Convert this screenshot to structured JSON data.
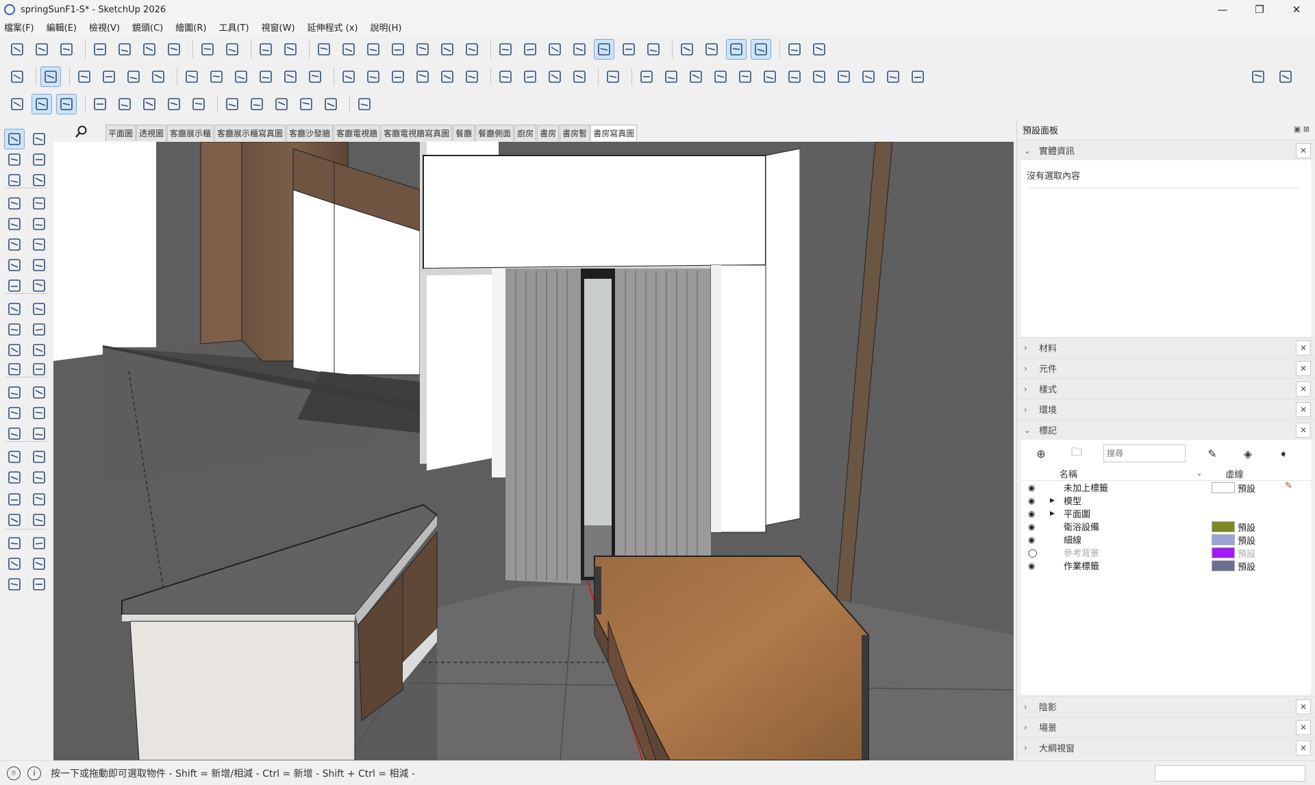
{
  "window": {
    "title": "springSunF1-S* - SketchUp 2026",
    "minimize": "—",
    "restore": "❐",
    "close": "✕"
  },
  "menu": [
    "檔案(F)",
    "編輯(E)",
    "檢視(V)",
    "鏡頭(C)",
    "繪圖(R)",
    "工具(T)",
    "視窗(W)",
    "延伸程式 (x)",
    "說明(H)"
  ],
  "toolbar_row1_icons": [
    "new-file-icon",
    "open-file-icon",
    "save-icon",
    "cut-icon",
    "copy-icon",
    "paste-icon",
    "delete-icon",
    "undo-icon",
    "redo-icon",
    "print-icon",
    "model-info-icon",
    "iso-view-icon",
    "top-view-icon",
    "front-view-icon",
    "right-view-icon",
    "back-view-icon",
    "left-view-icon",
    "bottom-view-icon",
    "xray-icon",
    "backedges-icon",
    "wireframe-icon",
    "hidden-line-icon",
    "shaded-icon",
    "shaded-textures-icon",
    "monochrome-icon",
    "section-plane-icon",
    "section-cut-icon",
    "section-fill-icon",
    "display-section-icon",
    "styles-icon",
    "warehouse-icon"
  ],
  "toolbar_row2_icons": [
    "zoom-icon",
    "select-icon",
    "eraser-icon",
    "pencil-line-icon",
    "arc-icon",
    "rectangle-icon",
    "push-pull-icon",
    "follow-me-icon",
    "move-icon",
    "rotate-icon",
    "scale-icon",
    "flip-icon",
    "paint-bucket-icon",
    "tape-measure-icon",
    "orbit-icon",
    "pan-icon",
    "zoom-window-icon",
    "zoom-extents-icon",
    "sandbox-icon",
    "solid-tools-icon",
    "layers-icon",
    "components-icon",
    "camera-icon",
    "extension-1-icon",
    "extension-2-icon",
    "extension-3-icon",
    "extension-4-icon",
    "extension-5-icon",
    "extension-6-icon",
    "extension-7-icon",
    "extension-8-icon",
    "extension-9-icon",
    "extension-10-icon",
    "extension-11-icon",
    "extension-12-icon",
    "new-doc-icon",
    "account-icon"
  ],
  "toolbar_row3_icons": [
    "extension-manager-icon",
    "trimble-connect-icon",
    "export-icon",
    "add-location-icon",
    "solid-inspector-icon",
    "library-icon",
    "checker-icon",
    "cloud-upload-icon",
    "settings-icon",
    "outliner-icon",
    "info-icon",
    "cart-icon",
    "user-icon",
    "ai-sparkle-icon"
  ],
  "scene_tabs": [
    "平面圖",
    "透視圖",
    "客廳展示櫃",
    "客廳展示櫃寫真圖",
    "客廳沙發牆",
    "客廳電視牆",
    "客廳電視牆寫真圖",
    "餐廳",
    "餐廳側面",
    "廚房",
    "書房",
    "書房暫",
    "書房寫真圖"
  ],
  "active_scene": "書房寫真圖",
  "panel": {
    "title": "預設面板",
    "entity_info": {
      "label": "實體資訊",
      "empty_text": "沒有選取內容"
    },
    "sections_collapsed_top": [
      "材料",
      "元件",
      "樣式",
      "環境"
    ],
    "tags_label": "標記",
    "search_placeholder": "搜尋",
    "col_name": "名稱",
    "col_dash": "虛線",
    "tags": [
      {
        "name": "未加上標籤",
        "dash": "預設",
        "color": "#ffffff",
        "visible": true,
        "expandable": false,
        "pencil": true
      },
      {
        "name": "模型",
        "dash": "",
        "color": "",
        "visible": true,
        "expandable": true,
        "pencil": false
      },
      {
        "name": "平面圖",
        "dash": "",
        "color": "",
        "visible": true,
        "expandable": true,
        "pencil": false
      },
      {
        "name": "衛浴設備",
        "dash": "預設",
        "color": "#7d8a22",
        "visible": true,
        "expandable": false,
        "pencil": false
      },
      {
        "name": "細線",
        "dash": "預設",
        "color": "#9ea3d6",
        "visible": true,
        "expandable": false,
        "pencil": false
      },
      {
        "name": "參考背景",
        "dash": "預設",
        "color": "#a21bf7",
        "visible": false,
        "expandable": false,
        "pencil": false
      },
      {
        "name": "作業標籤",
        "dash": "預設",
        "color": "#6c6e93",
        "visible": true,
        "expandable": false,
        "pencil": false
      }
    ],
    "sections_collapsed_bottom": [
      "陰影",
      "場景",
      "大綱視窗"
    ]
  },
  "status": {
    "text": "按一下或拖動即可選取物件 - Shift = 新增/相減 - Ctrl = 新增 - Shift + Ctrl = 相減 -"
  }
}
